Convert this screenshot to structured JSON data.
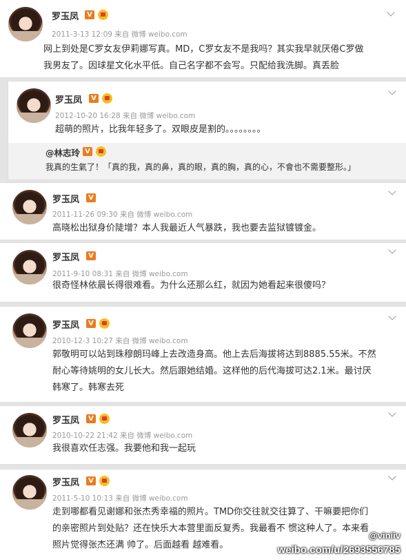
{
  "posts": [
    {
      "user": "罗玉凤",
      "meta": "2011-3-13 12:09 来自 微博 weibo.com",
      "lines": [
        "网上到处是C罗女友伊莉娜写真。MD，C罗女友不是我吗？其实我早就厌倦C罗做",
        "我男友了。因球星文化水平低。自己名字都不会写。只配给我洗脚。真丢脸"
      ]
    },
    {
      "user": "罗玉凤",
      "meta": "2012-10-20 16:28 来自 微博 weibo.com",
      "lines": [
        "超萌的照片，比我年轻多了。双眼皮是割的。。。。。。。。"
      ],
      "repost": {
        "user": "@林志玲",
        "text": "我真的生氣了！「真的我，真的鼻，真的眼，真的胸，真的心，不會也不需要整形。」"
      }
    },
    {
      "user": "罗玉凤",
      "meta": "2011-11-26 09:30 来自 微博 weibo.com",
      "lines": [
        "高晓松出狱身价陡增？本人我最近人气暴跌，我也要去监狱镀镀金。"
      ]
    },
    {
      "user": "罗玉凤",
      "meta": "2011-9-10 08:31 来自 微博 weibo.com",
      "lines": [
        "很奇怪林依晨长得很难看。为什么还那么红，就因为她看起来很傻吗？"
      ]
    },
    {
      "user": "罗玉凤",
      "meta": "2010-12-3 10:27 来自 微博 weibo.com",
      "lines": [
        "郭敬明可以站到珠穆朗玛峰上去改造身高。他上去后海拔将达到8885.55米。不然",
        "耐心等待姚明的女儿长大。然后跟她结婚。这样他的后代海拔可达2.1米。最讨厌",
        "韩寒了。韩寒去死"
      ]
    },
    {
      "user": "罗玉凤",
      "meta": "2010-10-22 21:42 来自 微博 weibo.com",
      "lines": [
        "我很喜欢任志强。我要他和我一起玩"
      ]
    },
    {
      "user": "罗玉凤",
      "meta": "2011-5-10 10:13 来自 微博 weibo.com",
      "lines": [
        "走到哪都看见谢娜和张杰秀幸福的照片。TMD你交往就交往算了、干嘛要把你们",
        "的亲密照片到处贴？还在快乐大本营里面反复秀。我最看不 惯这种人了。本来看",
        "照片觉得张杰还满 帅了。后面越看 越难看。"
      ]
    }
  ],
  "watermark": {
    "handle": "@viniiv",
    "url": "weibo.com/u/2693556785"
  },
  "icons": {
    "verified": "verified-v-icon",
    "crown": "vip-crown-icon",
    "menu": "chevron-down-icon"
  },
  "colors": {
    "verified": "#ec7b1d",
    "meta": "#999999",
    "background": "#e4e4e4",
    "repost_bg": "#f2f2f2"
  }
}
